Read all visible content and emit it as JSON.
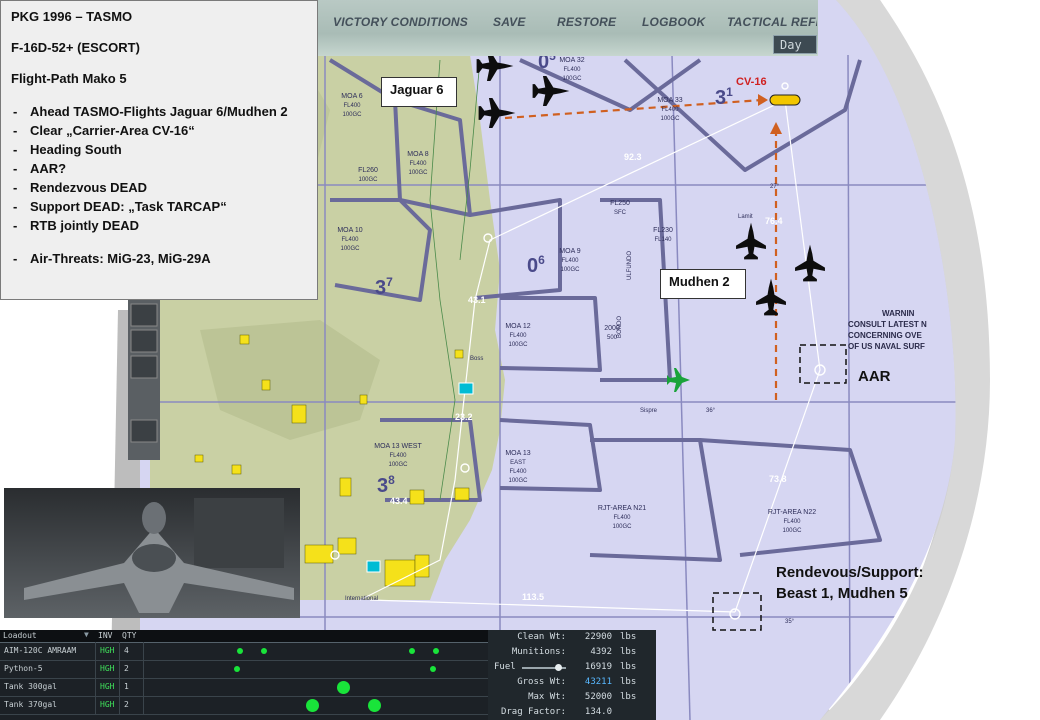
{
  "nav": {
    "items": [
      "VICTORY CONDITIONS",
      "SAVE",
      "RESTORE",
      "LOGBOOK",
      "TACTICAL REFE"
    ],
    "day_button": "Day"
  },
  "briefing": {
    "title": "PKG 1996 – TASMO",
    "aircraft": "F-16D-52+ (ESCORT)",
    "flight_path": "Flight-Path Mako 5",
    "tasks": [
      "Ahead TASMO-Flights Jaguar 6/Mudhen 2",
      "Clear „Carrier-Area CV-16“",
      "Heading South",
      "AAR?",
      "Rendezvous DEAD",
      "Support DEAD: „Task TARCAP“",
      "RTB jointly DEAD"
    ],
    "threats": "Air-Threats: MiG-23, MiG-29A"
  },
  "callouts": {
    "jaguar": "Jaguar 6",
    "mudhen": "Mudhen 2",
    "cv16": "CV-16",
    "aar": "AAR",
    "rendezvous_line1": "Rendevous/Support:",
    "rendezvous_line2": "Beast 1, Mudhen 5"
  },
  "map": {
    "airspace_labels": [
      {
        "id": "moa6",
        "lines": [
          "MOA 6",
          "FL400",
          "100GC"
        ]
      },
      {
        "id": "moa8",
        "lines": [
          "MOA 8",
          "FL400",
          "100GC"
        ]
      },
      {
        "id": "moa10",
        "lines": [
          "MOA 10",
          "FL400",
          "100GC"
        ]
      },
      {
        "id": "moa32",
        "lines": [
          "MOA 32",
          "FL400",
          "100GC"
        ]
      },
      {
        "id": "moa33",
        "lines": [
          "MOA 33",
          "FL400",
          "100GC"
        ]
      },
      {
        "id": "moa9",
        "lines": [
          "MOA 9",
          "FL400",
          "100GC"
        ]
      },
      {
        "id": "moa12",
        "lines": [
          "MOA 12",
          "FL400",
          "100GC"
        ]
      },
      {
        "id": "moa13w",
        "lines": [
          "MOA 13 WEST",
          "FL400",
          "100GC"
        ]
      },
      {
        "id": "moa13e",
        "lines": [
          "MOA 13",
          "EAST",
          "FL400",
          "100GC"
        ]
      },
      {
        "id": "rjt21",
        "lines": [
          "RJT-AREA N21",
          "FL400",
          "100GC"
        ]
      },
      {
        "id": "rjt22",
        "lines": [
          "RJT-AREA N22",
          "FL400",
          "100GC"
        ]
      },
      {
        "id": "s1",
        "lines": [
          "FL230",
          "FL140"
        ]
      },
      {
        "id": "s2",
        "lines": [
          "FL260",
          "100GC"
        ]
      },
      {
        "id": "s3",
        "lines": [
          "FL250",
          "SFC"
        ]
      },
      {
        "id": "s4",
        "lines": [
          "2000",
          "500"
        ]
      }
    ],
    "sector_numbers": [
      "05",
      "31",
      "06",
      "37",
      "38"
    ],
    "numbers": [
      "92.3",
      "76.4",
      "43.1",
      "23.2",
      "73.8",
      "43.4",
      "113.5"
    ],
    "warning_lines": [
      "WARNIN",
      "CONSULT LATEST N",
      "CONCERNING OVE",
      "OF US NAVAL SURF"
    ],
    "misc": [
      "ULFUNDO",
      "BONDO",
      "Sispre",
      "Lamit",
      "Boss",
      "International",
      "36°",
      "27°",
      "35°"
    ]
  },
  "loadout": {
    "title": "Loadout",
    "col_inv": "INV",
    "col_qty": "QTY",
    "rows": [
      {
        "name": "AIM-120C AMRAAM",
        "inv": "HGH",
        "qty": "4"
      },
      {
        "name": "Python-5",
        "inv": "HGH",
        "qty": "2"
      },
      {
        "name": "Tank 300gal",
        "inv": "HGH",
        "qty": "1"
      },
      {
        "name": "Tank 370gal",
        "inv": "HGH",
        "qty": "2"
      }
    ],
    "dots": [
      {
        "row": 0,
        "pos": 0.28,
        "size": 6
      },
      {
        "row": 0,
        "pos": 0.35,
        "size": 6
      },
      {
        "row": 0,
        "pos": 0.78,
        "size": 6
      },
      {
        "row": 0,
        "pos": 0.85,
        "size": 6
      },
      {
        "row": 1,
        "pos": 0.27,
        "size": 6
      },
      {
        "row": 1,
        "pos": 0.84,
        "size": 6
      },
      {
        "row": 2,
        "pos": 0.58,
        "size": 13
      },
      {
        "row": 3,
        "pos": 0.49,
        "size": 13
      },
      {
        "row": 3,
        "pos": 0.67,
        "size": 13
      }
    ]
  },
  "weights": [
    {
      "label": "Clean Wt:",
      "value": "22900",
      "unit": "lbs",
      "accent": false
    },
    {
      "label": "Munitions:",
      "value": "4392",
      "unit": "lbs",
      "accent": false
    },
    {
      "label": "Fuel",
      "value": "16919",
      "unit": "lbs",
      "accent": false,
      "slider": true
    },
    {
      "label": "Gross Wt:",
      "value": "43211",
      "unit": "lbs",
      "accent": true
    },
    {
      "label": "Max Wt:",
      "value": "52000",
      "unit": "lbs",
      "accent": false
    },
    {
      "label": "Drag Factor:",
      "value": "134.0",
      "unit": "",
      "accent": false
    }
  ],
  "fuel_fraction": 0.82,
  "colors": {
    "water": "#d6d6f2",
    "land": "#c9d0a4",
    "airspace": "#6a6a9a",
    "route": "#d06020",
    "flightpath": "#ffffff",
    "threat": "#f5e11a",
    "callout_red": "#d02020"
  }
}
